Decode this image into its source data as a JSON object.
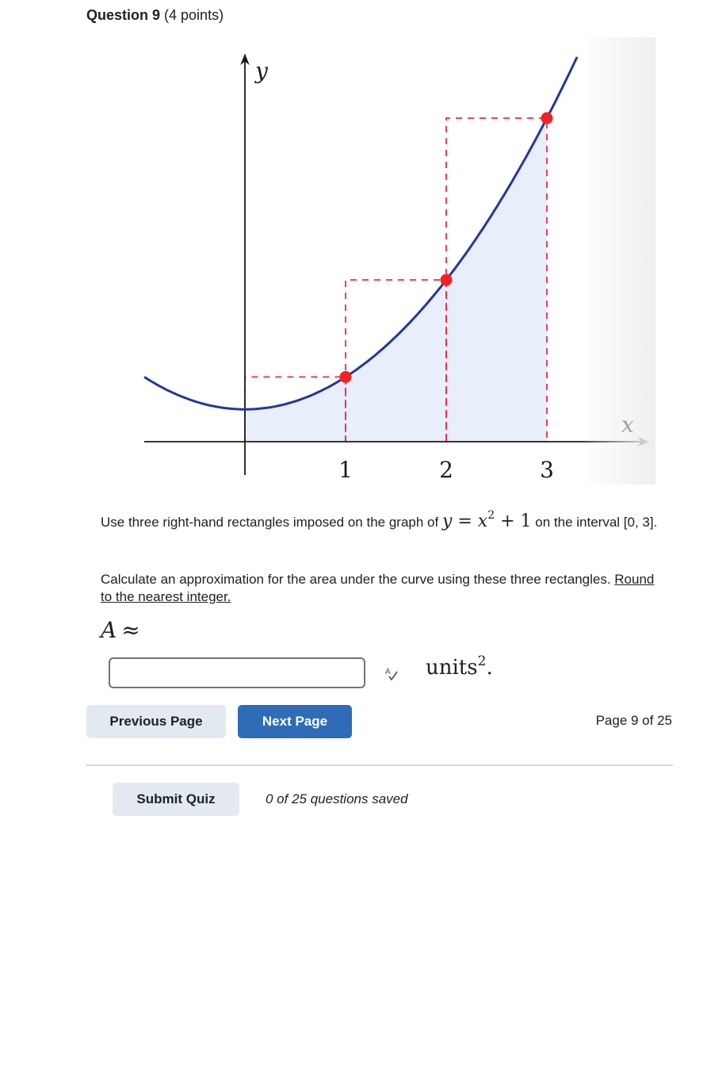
{
  "question": {
    "number_label": "Question 9",
    "points_label": "(4 points)"
  },
  "chart_data": {
    "type": "line",
    "title": "",
    "function": "y = x^2 + 1",
    "xlabel": "x",
    "ylabel": "y",
    "xlim": [
      -1,
      4
    ],
    "ylim": [
      0,
      11
    ],
    "x_ticks": [
      1,
      2,
      3
    ],
    "x_tick_labels": [
      "1",
      "2",
      "3"
    ],
    "curve": {
      "name": "y = x^2 + 1",
      "x": [
        -1.0,
        -0.5,
        0,
        0.5,
        1,
        1.5,
        2,
        2.5,
        3,
        3.3
      ],
      "y": [
        2.0,
        1.25,
        1,
        1.25,
        2,
        3.25,
        5,
        7.25,
        10,
        11.89
      ],
      "color": "#23379b"
    },
    "shaded_region": {
      "from_x": 0,
      "to_x": 3,
      "color": "#e8eefa"
    },
    "right_endpoint_points": [
      {
        "x": 1,
        "y": 2
      },
      {
        "x": 2,
        "y": 5
      },
      {
        "x": 3,
        "y": 10
      }
    ],
    "rectangles": [
      {
        "x0": 0,
        "x1": 1,
        "height": 2
      },
      {
        "x0": 1,
        "x1": 2,
        "height": 5
      },
      {
        "x0": 2,
        "x1": 3,
        "height": 10
      }
    ],
    "point_color": "#f22222",
    "rectangle_color": "#ee2a44",
    "grid": false,
    "legend": "none"
  },
  "prompt": {
    "line1_before": "Use three right-hand rectangles imposed on the graph of ",
    "eq_y": "y",
    "eq_equals": " = ",
    "eq_x": "x",
    "eq_exp": "2",
    "eq_plus": " + 1",
    "line1_after": " on the interval [0, 3].",
    "line2_plain": "Calculate an approximation for the area under the curve using these three rectangles. ",
    "line2_underlined": "Round to the nearest integer."
  },
  "answer": {
    "symbol": "A",
    "operator": "≈",
    "input_value": "",
    "input_placeholder": "",
    "units_label": "units",
    "units_exp": "2",
    "units_period": ".",
    "spellcheck_icon": "spellcheck-icon"
  },
  "navigation": {
    "previous_label": "Previous Page",
    "next_label": "Next Page",
    "page_indicator": "Page 9 of 25",
    "next_color": "#2f6cb8"
  },
  "footer": {
    "submit_label": "Submit Quiz",
    "saved_status": "0 of 25 questions saved"
  }
}
